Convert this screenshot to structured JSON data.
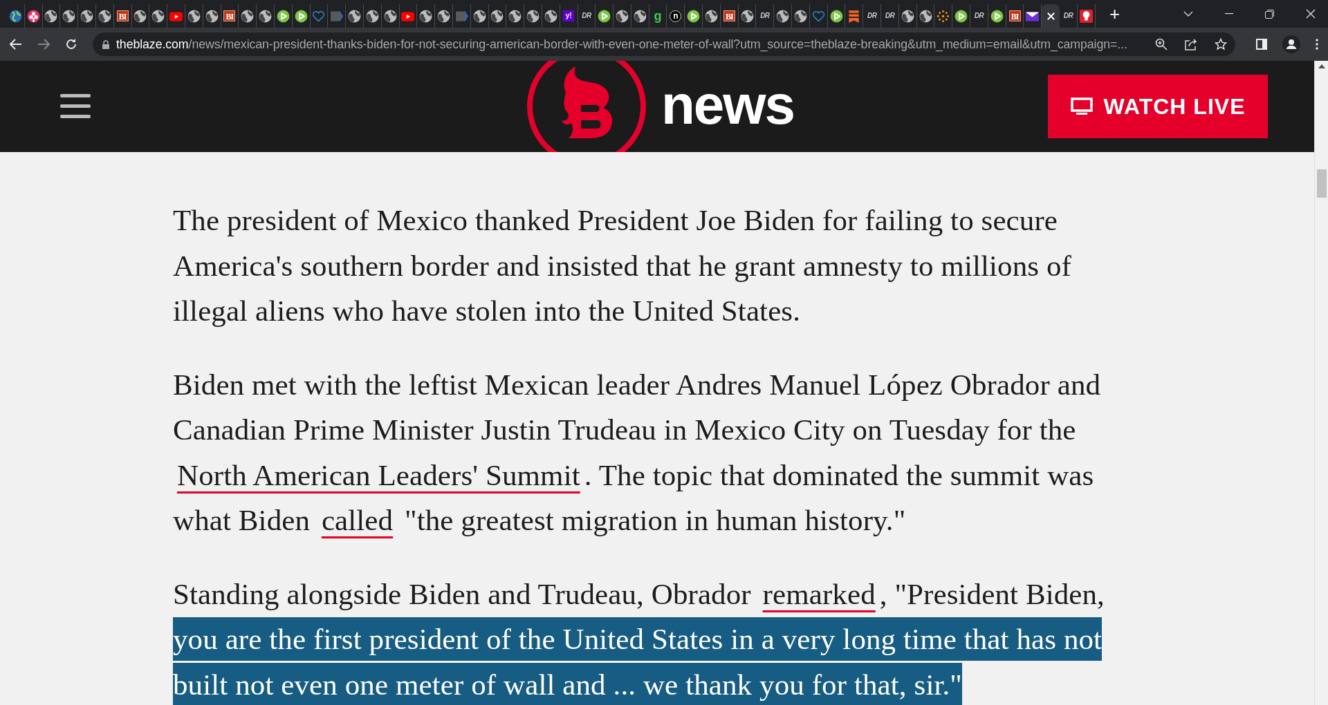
{
  "browser": {
    "tabs": [
      {
        "kind": "earth",
        "selected": false
      },
      {
        "kind": "flower",
        "selected": false
      },
      {
        "kind": "globe",
        "selected": false
      },
      {
        "kind": "globe",
        "selected": false
      },
      {
        "kind": "globe",
        "selected": false
      },
      {
        "kind": "globe",
        "selected": false
      },
      {
        "kind": "letter",
        "glyph": "BI",
        "selected": false
      },
      {
        "kind": "globe",
        "selected": false
      },
      {
        "kind": "globe",
        "selected": false
      },
      {
        "kind": "youtube",
        "selected": false
      },
      {
        "kind": "globe",
        "selected": false
      },
      {
        "kind": "globe",
        "selected": false
      },
      {
        "kind": "letter",
        "glyph": "BI",
        "selected": false
      },
      {
        "kind": "globe",
        "selected": false
      },
      {
        "kind": "globe",
        "selected": false
      },
      {
        "kind": "play",
        "selected": false
      },
      {
        "kind": "play",
        "selected": false
      },
      {
        "kind": "heart",
        "selected": false
      },
      {
        "kind": "chevron",
        "selected": false
      },
      {
        "kind": "globe",
        "selected": false
      },
      {
        "kind": "globe",
        "selected": false
      },
      {
        "kind": "globe",
        "selected": false
      },
      {
        "kind": "youtube",
        "selected": false
      },
      {
        "kind": "globe",
        "selected": false
      },
      {
        "kind": "globe",
        "selected": false
      },
      {
        "kind": "chevron",
        "selected": false
      },
      {
        "kind": "globe",
        "selected": false
      },
      {
        "kind": "globe",
        "selected": false
      },
      {
        "kind": "globe",
        "selected": false
      },
      {
        "kind": "globe",
        "selected": false
      },
      {
        "kind": "globe",
        "selected": false
      },
      {
        "kind": "yahoo",
        "glyph": "y!",
        "selected": false
      },
      {
        "kind": "dr",
        "glyph": "DR",
        "selected": false
      },
      {
        "kind": "play",
        "selected": false
      },
      {
        "kind": "globe",
        "selected": false
      },
      {
        "kind": "globe",
        "selected": false
      },
      {
        "kind": "green",
        "glyph": "g",
        "selected": false
      },
      {
        "kind": "round",
        "glyph": "n",
        "selected": false
      },
      {
        "kind": "play",
        "selected": false
      },
      {
        "kind": "globe",
        "selected": false
      },
      {
        "kind": "letter",
        "glyph": "BI",
        "selected": false
      },
      {
        "kind": "globe",
        "selected": false
      },
      {
        "kind": "dr",
        "glyph": "DR",
        "selected": false
      },
      {
        "kind": "globe",
        "selected": false
      },
      {
        "kind": "globe",
        "selected": false
      },
      {
        "kind": "heart",
        "selected": false
      },
      {
        "kind": "play",
        "selected": false
      },
      {
        "kind": "bookmark",
        "selected": false
      },
      {
        "kind": "dr",
        "glyph": "DR",
        "selected": false
      },
      {
        "kind": "dr",
        "glyph": "DR",
        "selected": false
      },
      {
        "kind": "globe",
        "selected": false
      },
      {
        "kind": "globe",
        "selected": false
      },
      {
        "kind": "spark",
        "selected": false
      },
      {
        "kind": "play",
        "selected": false
      },
      {
        "kind": "dr",
        "glyph": "DR",
        "selected": false
      },
      {
        "kind": "play",
        "selected": false
      },
      {
        "kind": "letter",
        "glyph": "BI",
        "selected": false
      },
      {
        "kind": "mail",
        "selected": false
      },
      {
        "kind": "close",
        "selected": true
      },
      {
        "kind": "dr",
        "glyph": "DR",
        "selected": false
      },
      {
        "kind": "pin",
        "selected": false
      }
    ],
    "new_tab": "+",
    "address": {
      "host": "theblaze.com",
      "path": "/news/mexican-president-thanks-biden-for-not-securing-american-border-with-even-one-meter-of-wall?utm_source=theblaze-breaking&utm_medium=email&utm_campaign=..."
    }
  },
  "site_header": {
    "brand": "news",
    "watch_button": "WATCH LIVE"
  },
  "article": {
    "paragraphs": [
      {
        "lines": [
          [
            {
              "kind": "text",
              "text": "The president of Mexico thanked President Joe Biden for failing to secure"
            }
          ],
          [
            {
              "kind": "text",
              "text": "America's southern border and insisted that he grant amnesty to millions of"
            }
          ],
          [
            {
              "kind": "text",
              "text": "illegal aliens who have stolen into the United States."
            }
          ]
        ]
      },
      {
        "lines": [
          [
            {
              "kind": "text",
              "text": "Biden met with the leftist Mexican leader Andres Manuel López Obrador and"
            }
          ],
          [
            {
              "kind": "text",
              "text": "Canadian Prime Minister Justin Trudeau in Mexico City on Tuesday for the"
            }
          ],
          [
            {
              "kind": "link",
              "text": "North American Leaders' Summit"
            },
            {
              "kind": "text",
              "text": ". The topic that dominated the summit was"
            }
          ],
          [
            {
              "kind": "text",
              "text": "what Biden "
            },
            {
              "kind": "link",
              "text": "called"
            },
            {
              "kind": "text",
              "text": " \"the greatest migration in human history.\""
            }
          ]
        ]
      },
      {
        "lines": [
          [
            {
              "kind": "text",
              "text": "Standing alongside Biden and Trudeau, Obrador "
            },
            {
              "kind": "link",
              "text": "remarked"
            },
            {
              "kind": "text",
              "text": ", \"President Biden,"
            }
          ],
          [
            {
              "kind": "highlight",
              "text": "you are the first president of the United States in a very long time that has not"
            }
          ],
          [
            {
              "kind": "highlight",
              "text": "built not even one meter of wall and ... we thank you for that, sir.\""
            }
          ]
        ]
      }
    ]
  }
}
